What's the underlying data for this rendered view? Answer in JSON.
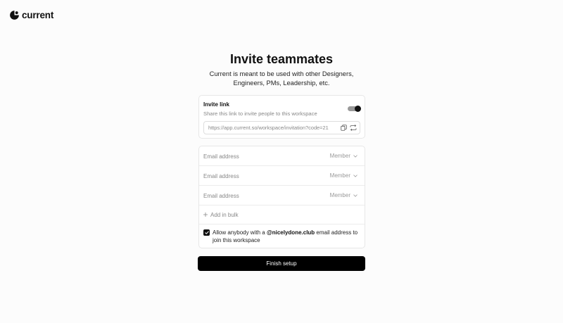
{
  "brand": {
    "name": "current",
    "logo_icon": "current-logo-icon"
  },
  "page": {
    "title": "Invite teammates",
    "subtitle": "Current is meant to be used with other Designers, Engineers, PMs, Leadership, etc."
  },
  "invite_link": {
    "label": "Invite link",
    "description": "Share this link to invite people to this workspace",
    "enabled": true,
    "url": "https://app.current.so/workspace/invitation?code=21",
    "copy_icon": "copy-icon",
    "refresh_icon": "refresh-icon"
  },
  "invites": {
    "rows": [
      {
        "placeholder": "Email address",
        "value": "",
        "role": "Member"
      },
      {
        "placeholder": "Email address",
        "value": "",
        "role": "Member"
      },
      {
        "placeholder": "Email address",
        "value": "",
        "role": "Member"
      }
    ],
    "add_bulk_label": "Add in bulk"
  },
  "domain_join": {
    "checked": true,
    "text_before": "Allow anybody with a ",
    "domain": "@nicelydone.club",
    "text_after": " email address to join this workspace"
  },
  "actions": {
    "finish_label": "Finish setup"
  },
  "colors": {
    "primary": "#000000",
    "background": "#fcfcfc",
    "muted_text": "#888888"
  }
}
